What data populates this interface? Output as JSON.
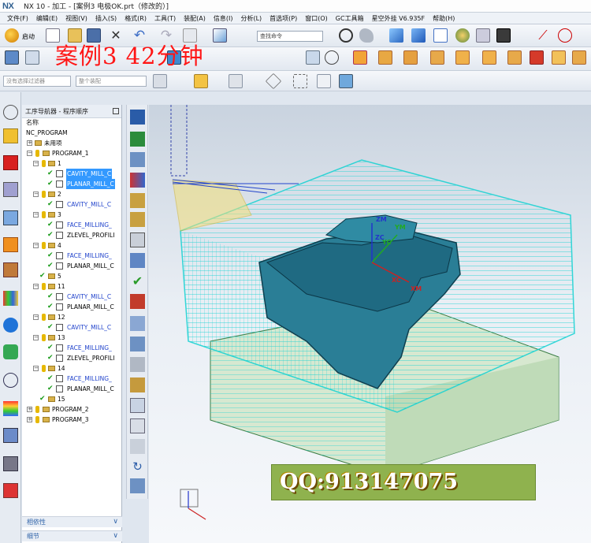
{
  "window": {
    "app_logo": "NX",
    "title": "NX 10 - 加工 - [案例3 电极OK.prt（修改的）]"
  },
  "menu": [
    "文件(F)",
    "编辑(E)",
    "视图(V)",
    "插入(S)",
    "格式(R)",
    "工具(T)",
    "装配(A)",
    "信息(I)",
    "分析(L)",
    "首选项(P)",
    "窗口(O)",
    "GC工具箱",
    "星空外挂 V6.935F",
    "帮助(H)"
  ],
  "toolbar": {
    "start_label": "启动",
    "search_placeholder": "查找命令",
    "filter_placeholder": "没有选择过滤器",
    "assembly_placeholder": "整个装配"
  },
  "overlay": {
    "title": "案例3   42分钟",
    "qq": "QQ:913147075"
  },
  "navigator": {
    "title": "工序导航器 - 程序顺序",
    "column_name": "名称",
    "root": "NC_PROGRAM",
    "unused": "未用项",
    "program1": "PROGRAM_1",
    "g1": "1",
    "op_cavity_1": "CAVITY_MILL_C",
    "op_planar_1": "PLANAR_MILL_C",
    "g2": "2",
    "op_cavity_2": "CAVITY_MILL_C",
    "g3": "3",
    "op_face_3": "FACE_MILLING_",
    "op_zlevel_3": "ZLEVEL_PROFILI",
    "g4": "4",
    "op_face_4": "FACE_MILLING_",
    "op_planar_4": "PLANAR_MILL_C",
    "g5": "5",
    "g11": "11",
    "op_cavity_11": "CAVITY_MILL_C",
    "op_planar_11": "PLANAR_MILL_C",
    "g12": "12",
    "op_cavity_12": "CAVITY_MILL_C",
    "g13": "13",
    "op_face_13": "FACE_MILLING_",
    "op_zlevel_13": "ZLEVEL_PROFILI",
    "g14": "14",
    "op_face_14": "FACE_MILLING_",
    "op_planar_14": "PLANAR_MILL_C",
    "g15": "15",
    "program2": "PROGRAM_2",
    "program3": "PROGRAM_3",
    "footer_dependency": "相依性",
    "footer_details": "细节"
  },
  "viewport": {
    "axis_zm": "ZM",
    "axis_zc": "ZC",
    "axis_ym": "YM",
    "axis_yc": "YC",
    "axis_xc": "XC",
    "axis_xm": "XM"
  },
  "colors": {
    "toolpath": "#14d2d2",
    "part": "#2a7e96",
    "selection": "#3399ff",
    "overlay_red": "#ff1616",
    "qq_bg": "#8fb24e"
  },
  "icons": [
    "nx-logo",
    "start-icon",
    "new-icon",
    "open-icon",
    "save-icon",
    "cut-icon",
    "undo-icon",
    "redo-icon",
    "zoom-icon",
    "view-cube-icon",
    "check-icon",
    "folder-icon",
    "wrench-icon",
    "pin-icon"
  ]
}
